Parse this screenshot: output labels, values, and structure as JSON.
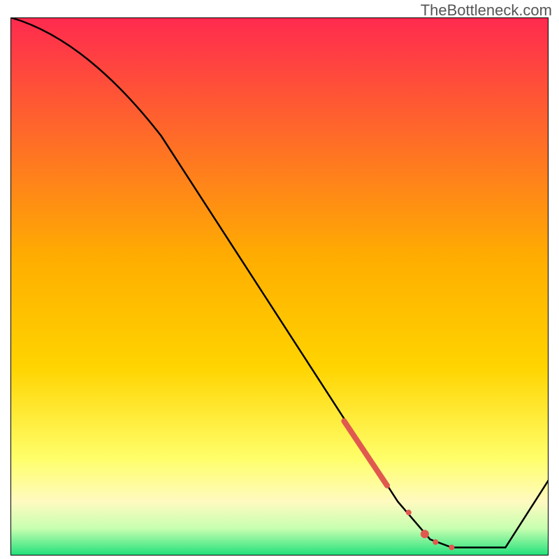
{
  "watermark": "TheBottleneck.com",
  "chart_data": {
    "type": "line",
    "title": "",
    "xlabel": "",
    "ylabel": "",
    "xlim": [
      0,
      100
    ],
    "ylim": [
      0,
      100
    ],
    "grid": false,
    "background_gradient": {
      "top": "#ff2a4f",
      "mid_upper": "#ffd400",
      "mid_lower": "#ffff6a",
      "band_pale": "#fffac0",
      "bottom": "#1fe07a"
    },
    "series": [
      {
        "name": "curve",
        "color": "#000000",
        "points": [
          {
            "x": 0,
            "y": 100
          },
          {
            "x": 28,
            "y": 78
          },
          {
            "x": 72,
            "y": 10
          },
          {
            "x": 78,
            "y": 3
          },
          {
            "x": 82,
            "y": 1.5
          },
          {
            "x": 92,
            "y": 1.5
          },
          {
            "x": 100,
            "y": 14
          }
        ]
      },
      {
        "name": "highlight-segment",
        "color": "#e0594f",
        "stroke_width": 8,
        "points": [
          {
            "x": 62,
            "y": 25
          },
          {
            "x": 70,
            "y": 13
          }
        ]
      }
    ],
    "markers": [
      {
        "name": "dot1",
        "x": 74,
        "y": 8,
        "r": 4,
        "color": "#e0594f"
      },
      {
        "name": "dot2",
        "x": 77,
        "y": 4,
        "r": 6,
        "color": "#e0594f"
      },
      {
        "name": "dot3",
        "x": 79,
        "y": 2.5,
        "r": 4,
        "color": "#e0594f"
      },
      {
        "name": "dot4",
        "x": 82,
        "y": 1.5,
        "r": 4,
        "color": "#e0594f"
      }
    ]
  }
}
